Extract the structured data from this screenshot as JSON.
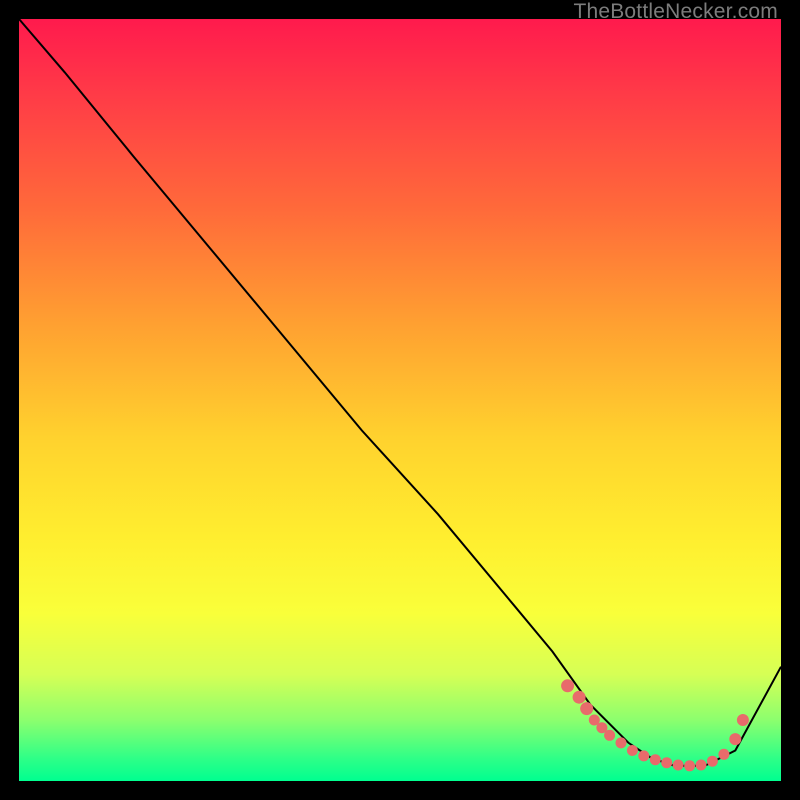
{
  "watermark": "TheBottleNecker.com",
  "chart_data": {
    "type": "line",
    "title": "",
    "xlabel": "",
    "ylabel": "",
    "xlim": [
      0,
      100
    ],
    "ylim": [
      0,
      100
    ],
    "series": [
      {
        "name": "bottleneck-curve",
        "x": [
          0,
          6,
          15,
          25,
          35,
          45,
          55,
          65,
          70,
          75,
          80,
          83,
          86,
          90,
          94,
          100
        ],
        "y": [
          100,
          93,
          82,
          70,
          58,
          46,
          35,
          23,
          17,
          10,
          5,
          3,
          2,
          2,
          4,
          15
        ]
      }
    ],
    "highlight_points": {
      "name": "optimal-range-dots",
      "x": [
        72,
        73.5,
        74.5,
        75.5,
        76.5,
        77.5,
        79,
        80.5,
        82,
        83.5,
        85,
        86.5,
        88,
        89.5,
        91,
        92.5,
        94,
        95
      ],
      "y": [
        12.5,
        11,
        9.5,
        8,
        7,
        6,
        5,
        4,
        3.3,
        2.8,
        2.4,
        2.1,
        2.0,
        2.1,
        2.6,
        3.5,
        5.5,
        8
      ]
    },
    "gradient_stops": [
      {
        "pos": 0.0,
        "color": "#ff1a4d"
      },
      {
        "pos": 0.55,
        "color": "#ffd22e"
      },
      {
        "pos": 0.97,
        "color": "#2fff87"
      },
      {
        "pos": 1.0,
        "color": "#00ff90"
      }
    ]
  }
}
